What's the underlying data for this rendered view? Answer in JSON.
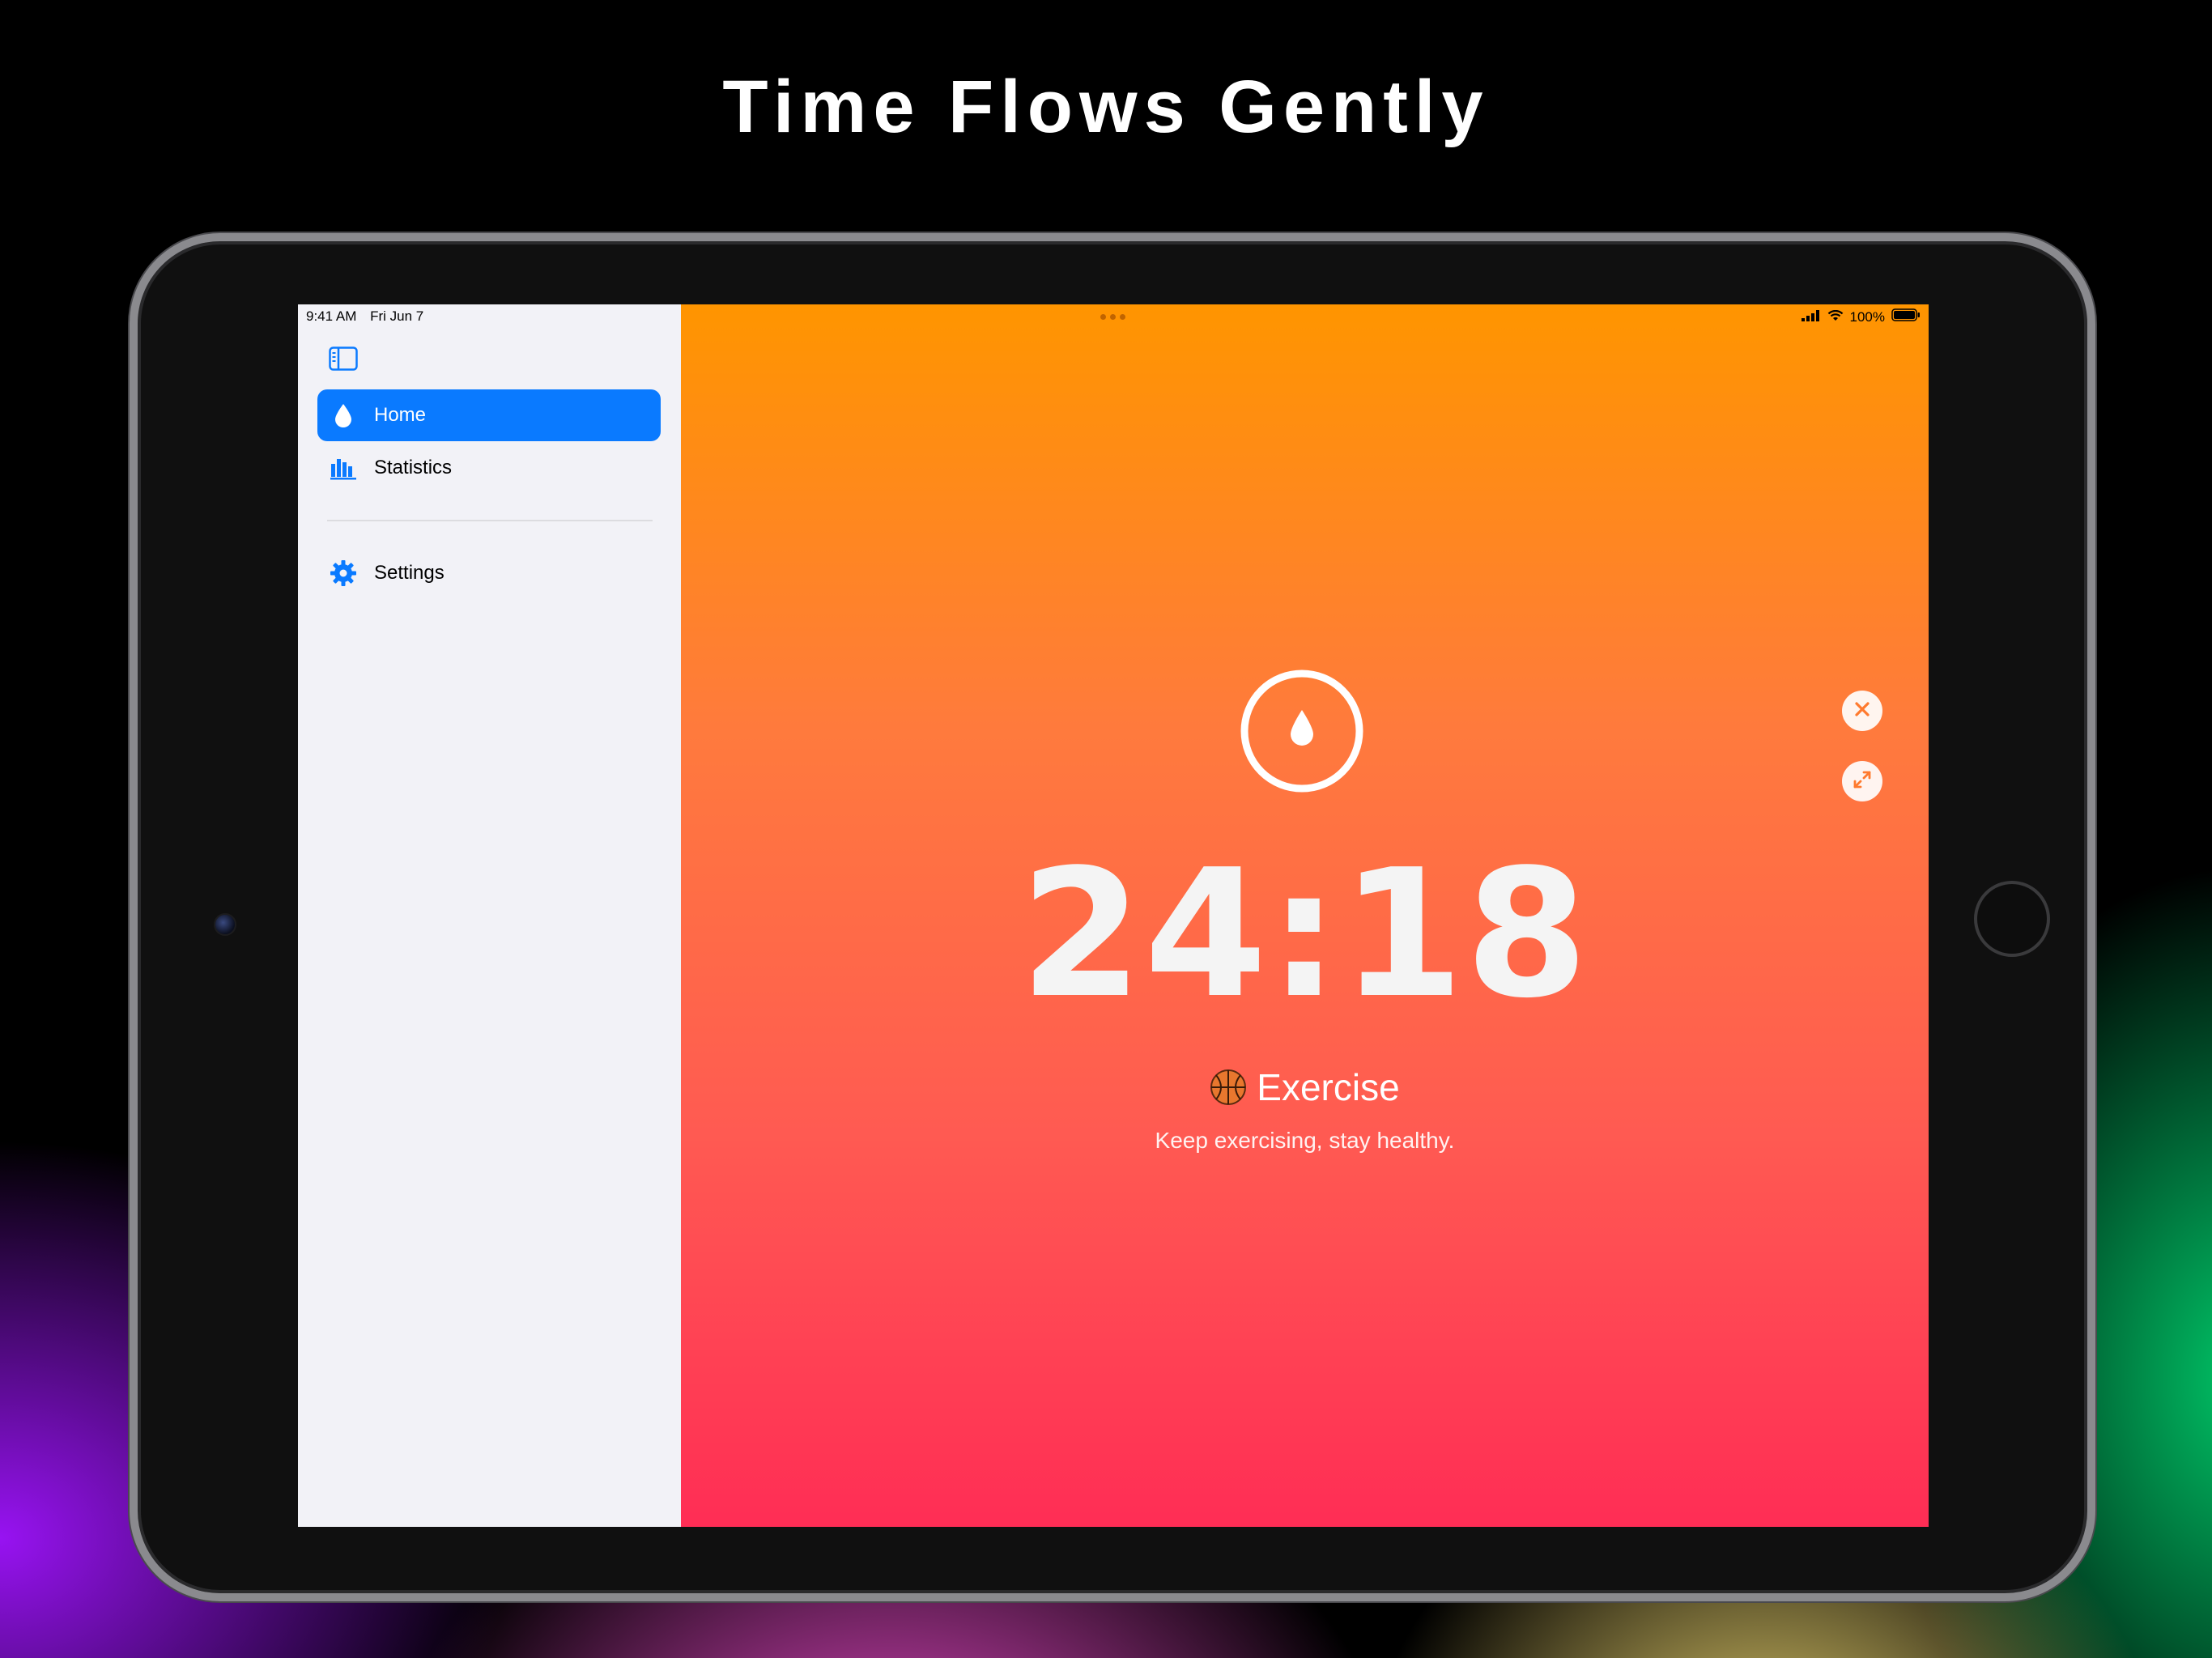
{
  "headline": "Time Flows Gently",
  "status_bar": {
    "time": "9:41 AM",
    "date": "Fri Jun 7",
    "battery": "100%"
  },
  "sidebar": {
    "toggle_icon": "sidebar-icon",
    "items": [
      {
        "label": "Home",
        "icon": "drop-icon",
        "selected": true
      },
      {
        "label": "Statistics",
        "icon": "chart-bar-icon",
        "selected": false
      }
    ],
    "footer_items": [
      {
        "label": "Settings",
        "icon": "gear-icon",
        "selected": false
      }
    ]
  },
  "timer_screen": {
    "time": "24:18",
    "activity_emoji_icon": "basketball-icon",
    "activity": "Exercise",
    "subtitle": "Keep exercising, stay healthy.",
    "close_icon": "close-icon",
    "expand_icon": "expand-icon"
  },
  "colors": {
    "accent": "#0A7AFF",
    "gradient_top": "#FF9500",
    "gradient_bottom": "#FF2D55"
  }
}
